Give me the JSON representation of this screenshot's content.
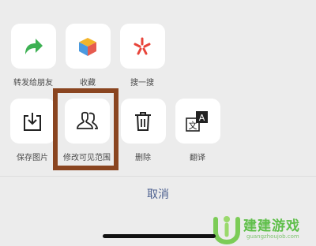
{
  "actions_row1": [
    {
      "label": "转发给朋友",
      "icon": "share-arrow-icon"
    },
    {
      "label": "收藏",
      "icon": "favorite-cube-icon"
    },
    {
      "label": "搜一搜",
      "icon": "search-star-icon"
    }
  ],
  "actions_row2": [
    {
      "label": "保存图片",
      "icon": "save-download-icon"
    },
    {
      "label": "修改可见范围",
      "icon": "people-visibility-icon"
    },
    {
      "label": "删除",
      "icon": "trash-icon"
    },
    {
      "label": "翻译",
      "icon": "translate-icon"
    }
  ],
  "cancel_label": "取消",
  "watermark": {
    "text": "建建游戏",
    "url": "guangzhoujob.com"
  },
  "colors": {
    "accent_green": "#3db153",
    "highlight_border": "#8a4520",
    "cancel_text": "#4b5f8f"
  }
}
